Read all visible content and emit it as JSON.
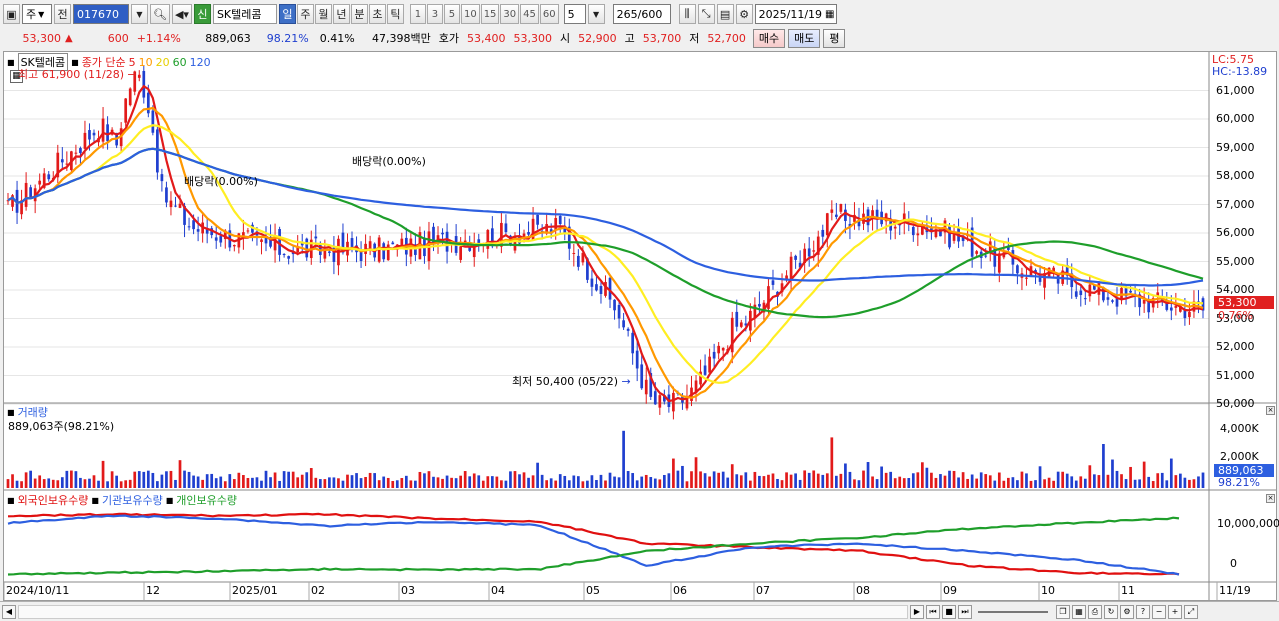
{
  "toolbar": {
    "period_select": "주",
    "prev_label": "전",
    "code": "017670",
    "stock_badge": "신",
    "stock_name": "SK텔레콤",
    "timeframes": [
      "일",
      "주",
      "월",
      "년",
      "분",
      "초",
      "틱"
    ],
    "numbers": [
      "1",
      "3",
      "5",
      "10",
      "15",
      "30",
      "45",
      "60"
    ],
    "multiplier": "5",
    "count_value": "265",
    "count_total": "/600",
    "date": "2025/11/19"
  },
  "quote": {
    "price": "53,300",
    "change": "600",
    "change_pct": "+1.14%",
    "volume": "889,063",
    "vol_ratio": "98.21%",
    "rate2": "0.41%",
    "amount": "47,398백만",
    "hoga_label": "호가",
    "ask": "53,400",
    "bid": "53,300",
    "open_label": "시",
    "open": "52,900",
    "high_label": "고",
    "high": "53,700",
    "low_label": "저",
    "low": "52,700",
    "buy_label": "매수",
    "sell_label": "매도",
    "avg_label": "평"
  },
  "main": {
    "stock_label": "SK텔레콤",
    "ma_title": "종가 단순",
    "ma_periods": [
      "5",
      "10",
      "20",
      "60",
      "120"
    ],
    "ma_colors": [
      "#e21a1a",
      "#ff9900",
      "#ffee22",
      "#1e9e2a",
      "#2d5fe0"
    ],
    "lc": "LC:5.75",
    "hc": "HC:-13.89",
    "high_marker": "최고 61,900 (11/28)",
    "low_marker": "최저 50,400 (05/22)",
    "div1": "배당락(0.00%)",
    "div2": "배당락(0.00%)",
    "price_ticks": [
      "61,000",
      "60,000",
      "59,000",
      "58,000",
      "57,000",
      "56,000",
      "55,000",
      "54,000",
      "53,000",
      "52,000",
      "51,000",
      "50,000"
    ],
    "last_price": "53,300",
    "last_pct": "0.76%"
  },
  "volume_pane": {
    "title": "거래량",
    "info": "889,063주(98.21%)",
    "ticks": [
      "4,000K",
      "2,000K"
    ],
    "last": "889,063",
    "last_pct": "98.21%"
  },
  "holding_pane": {
    "legend": [
      "외국인보유수량",
      "기관보유수량",
      "개인보유수량"
    ],
    "colors": [
      "#e01010",
      "#2d5fe0",
      "#1e9e2a"
    ],
    "ticks": [
      "10,000,000",
      "0"
    ]
  },
  "xaxis": {
    "labels": [
      "2024/10/11",
      "12",
      "2025/01",
      "02",
      "03",
      "04",
      "05",
      "06",
      "07",
      "08",
      "09",
      "10",
      "11",
      "11/19"
    ]
  },
  "chart_data": {
    "type": "candlestick",
    "title": "SK텔레콤",
    "period": "daily",
    "x_range": [
      "2024/10/11",
      "2025/11/19"
    ],
    "y_range": [
      50000,
      62000
    ],
    "moving_averages": [
      5,
      10,
      20,
      60,
      120
    ],
    "annotations": [
      {
        "text": "최고 61,900 (11/28)",
        "date": "11/28",
        "value": 61900
      },
      {
        "text": "최저 50,400 (05/22)",
        "date": "05/22",
        "value": 50400
      },
      {
        "text": "배당락(0.00%)"
      },
      {
        "text": "배당락(0.00%)"
      }
    ],
    "anchors": [
      {
        "month": "2024/10",
        "close": 56800
      },
      {
        "month": "2024/11",
        "close": 59800
      },
      {
        "month": "2024/12",
        "close": 56200
      },
      {
        "month": "2025/01",
        "close": 55400
      },
      {
        "month": "2025/02",
        "close": 55400
      },
      {
        "month": "2025/03",
        "close": 55800
      },
      {
        "month": "2025/04",
        "close": 56200
      },
      {
        "month": "2025/05",
        "close": 51500
      },
      {
        "month": "2025/06",
        "close": 52800
      },
      {
        "month": "2025/07",
        "close": 56600
      },
      {
        "month": "2025/08",
        "close": 56300
      },
      {
        "month": "2025/09",
        "close": 54800
      },
      {
        "month": "2025/10",
        "close": 53800
      },
      {
        "month": "2025/11",
        "close": 53300
      }
    ],
    "volume_last": 889063,
    "holdings": {
      "series": [
        {
          "name": "외국인보유수량"
        },
        {
          "name": "기관보유수량"
        },
        {
          "name": "개인보유수량"
        }
      ]
    }
  }
}
